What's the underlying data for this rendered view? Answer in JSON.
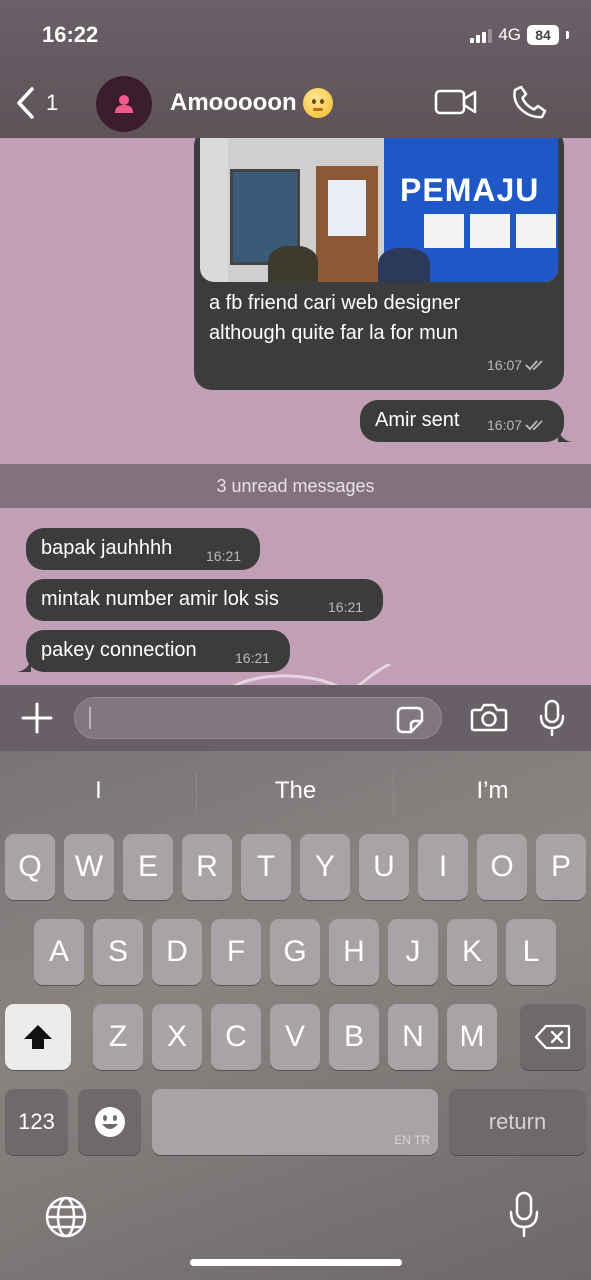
{
  "status": {
    "time": "16:22",
    "network": "4G",
    "battery": "84"
  },
  "header": {
    "back_count": "1",
    "contact_name": "Amooooon"
  },
  "photo": {
    "sign_text": "PEMAJU"
  },
  "messages": {
    "image_caption_1": "a fb friend cari web designer",
    "image_caption_2": "although quite far la for mun",
    "image_time": "16:07",
    "sent_text": "Amir sent",
    "sent_time": "16:07",
    "unread_label": "3 unread messages",
    "received": [
      {
        "text": "bapak jauhhhh",
        "time": "16:21"
      },
      {
        "text": "mintak number amir lok sis",
        "time": "16:21"
      },
      {
        "text": "pakey connection",
        "time": "16:21"
      }
    ]
  },
  "keyboard": {
    "suggestions": [
      "I",
      "The",
      "I’m"
    ],
    "row1": [
      "Q",
      "W",
      "E",
      "R",
      "T",
      "Y",
      "U",
      "I",
      "O",
      "P"
    ],
    "row2": [
      "A",
      "S",
      "D",
      "F",
      "G",
      "H",
      "J",
      "K",
      "L"
    ],
    "row3": [
      "Z",
      "X",
      "C",
      "V",
      "B",
      "N",
      "M"
    ],
    "numbers_key": "123",
    "return_key": "return",
    "space_hint": "EN TR"
  }
}
